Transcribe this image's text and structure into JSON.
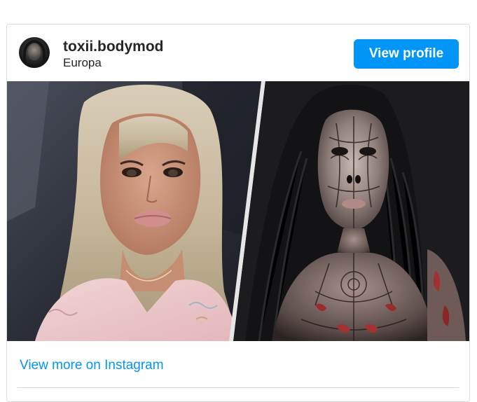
{
  "post": {
    "username": "toxii.bodymod",
    "location": "Europa",
    "avatar_icon": "profile-avatar",
    "view_profile_label": "View profile",
    "view_more_label": "View more on Instagram",
    "media_icon": "photo-collage"
  },
  "colors": {
    "accent": "#0095f6",
    "text": "#262626",
    "border": "#dbdbdb"
  }
}
